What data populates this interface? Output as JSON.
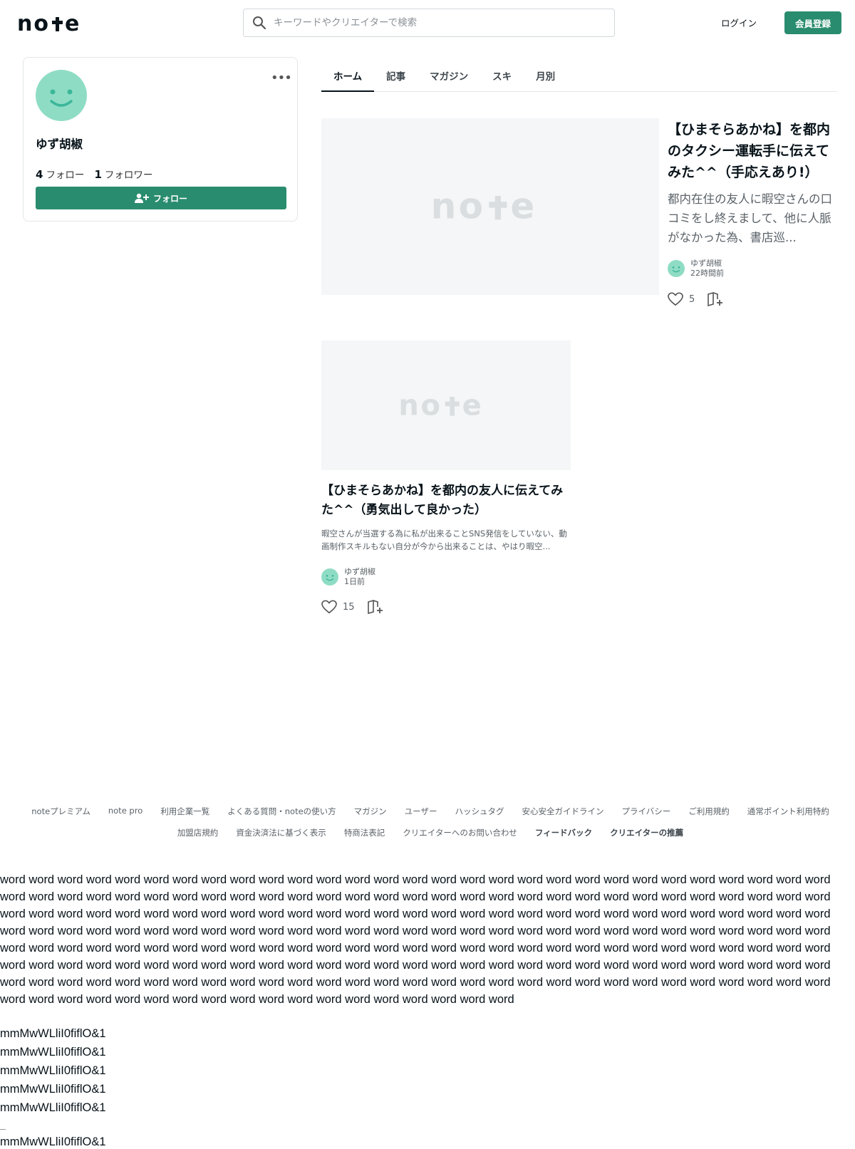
{
  "header": {
    "logo_text": "note",
    "search_placeholder": "キーワードやクリエイターで検索",
    "login_label": "ログイン",
    "signup_label": "会員登録"
  },
  "profile": {
    "name": "ゆず胡椒",
    "follow_count": "4",
    "follow_label": "フォロー",
    "follower_count": "1",
    "follower_label": "フォロワー",
    "follow_button_label": "フォロー",
    "menu_label": "•••"
  },
  "tabs": [
    {
      "label": "ホーム",
      "active": true
    },
    {
      "label": "記事",
      "active": false
    },
    {
      "label": "マガジン",
      "active": false
    },
    {
      "label": "スキ",
      "active": false
    },
    {
      "label": "月別",
      "active": false
    }
  ],
  "articles": [
    {
      "title": "【ひまそらあかね】を都内のタクシー運転手に伝えてみた^^（手応えあり!）",
      "excerpt": "都内在住の友人に暇空さんの口コミをし終えまして、他に人脈がなかった為、書店巡...",
      "author": "ゆず胡椒",
      "time": "22時間前",
      "likes": "5"
    },
    {
      "title": "【ひまそらあかね】を都内の友人に伝えてみた^^（勇気出して良かった）",
      "excerpt": "暇空さんが当選する為に私が出来ることSNS発信をしていない、動画制作スキルもない自分が今から出来ることは、やはり暇空...",
      "author": "ゆず胡椒",
      "time": "1日前",
      "likes": "15"
    }
  ],
  "footer": {
    "row1": [
      "noteプレミアム",
      "note pro",
      "利用企業一覧",
      "よくある質問・noteの使い方",
      "マガジン",
      "ユーザー",
      "ハッシュタグ",
      "安心安全ガイドライン",
      "プライバシー",
      "ご利用規約",
      "通常ポイント利用特約"
    ],
    "row2": [
      "加盟店規約",
      "資金決済法に基づく表示",
      "特商法表記",
      "クリエイターへのお問い合わせ"
    ],
    "row2_bold": [
      "フィードバック",
      "クリエイターの推薦"
    ]
  },
  "filler": {
    "words": "word word word word word word word word word word word word word word word word word word word word word word word word word word word word word word word word word word word word word word word word word word word word word word word word word word word word word word word word word word word word word word word word word word word word word word word word word word word word word word word word word word word word word word word word word word word word word word word word word word word word word word word word word word word word word word word word word word word word word word word word word word word word word word word word word word word word word word word word word word word word word word word word word word word word word word word word word word word word word word word word word word word word word word word word word word word word word word word word word word word word word word word word word word word word word word word word word word word word word word word word word word word word word word word word word word word word word word word word word word word word word",
    "mm": "mmMwWLliI0fiflO&1"
  },
  "colors": {
    "brand_green": "#2a8c6e",
    "avatar_mint": "#8fdcc5"
  }
}
